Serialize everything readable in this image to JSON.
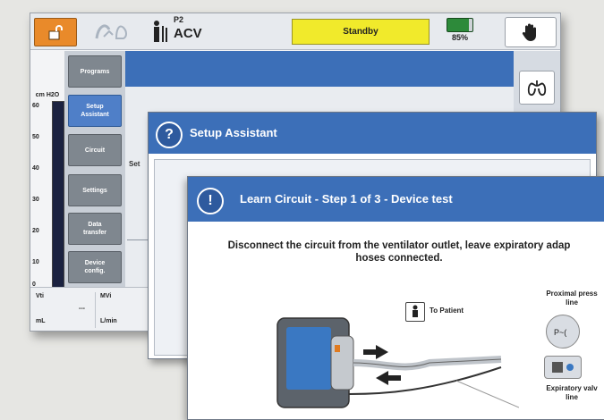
{
  "main_screen": {
    "topbar": {
      "patient_type_small": "P2",
      "mode": "ACV",
      "status": "Standby",
      "battery_percent": "85%",
      "battery_level": 0.85
    },
    "gauge": {
      "unit": "cm H2O",
      "ticks": [
        "60",
        "50",
        "40",
        "30",
        "20",
        "10",
        "0"
      ]
    },
    "sidebar": {
      "items": [
        {
          "label": "Programs"
        },
        {
          "label": "Setup\nAssistant"
        },
        {
          "label": "Circuit"
        },
        {
          "label": "Settings"
        },
        {
          "label": "Data\ntransfer"
        },
        {
          "label": "Device\nconfig."
        }
      ],
      "active_index": 1
    },
    "partial_text": "Set",
    "readings": [
      {
        "label": "Vti",
        "value": "---",
        "unit": "mL"
      },
      {
        "label": "MVi",
        "value": "",
        "unit": "L/min"
      }
    ]
  },
  "setup_window": {
    "title": "Setup Assistant",
    "icon": "question-icon",
    "icon_glyph": "?"
  },
  "learn_window": {
    "title": "Learn Circuit - Step 1 of 3 - Device test",
    "icon": "exclamation-icon",
    "icon_glyph": "!",
    "instruction": "Disconnect the circuit from the ventilator outlet, leave expiratory adap\nhoses connected.",
    "to_patient_label": "To Patient",
    "proximal_label": "Proximal press\nline",
    "expiratory_label": "Expiratory valv\nline"
  },
  "colors": {
    "accent_blue": "#3c6fb8",
    "lock_orange": "#e98a2a",
    "status_yellow": "#f1ea2b",
    "battery_green": "#2d8a3a",
    "sidebar_gray": "#7f878f",
    "sidebar_active": "#4f7fc8"
  }
}
